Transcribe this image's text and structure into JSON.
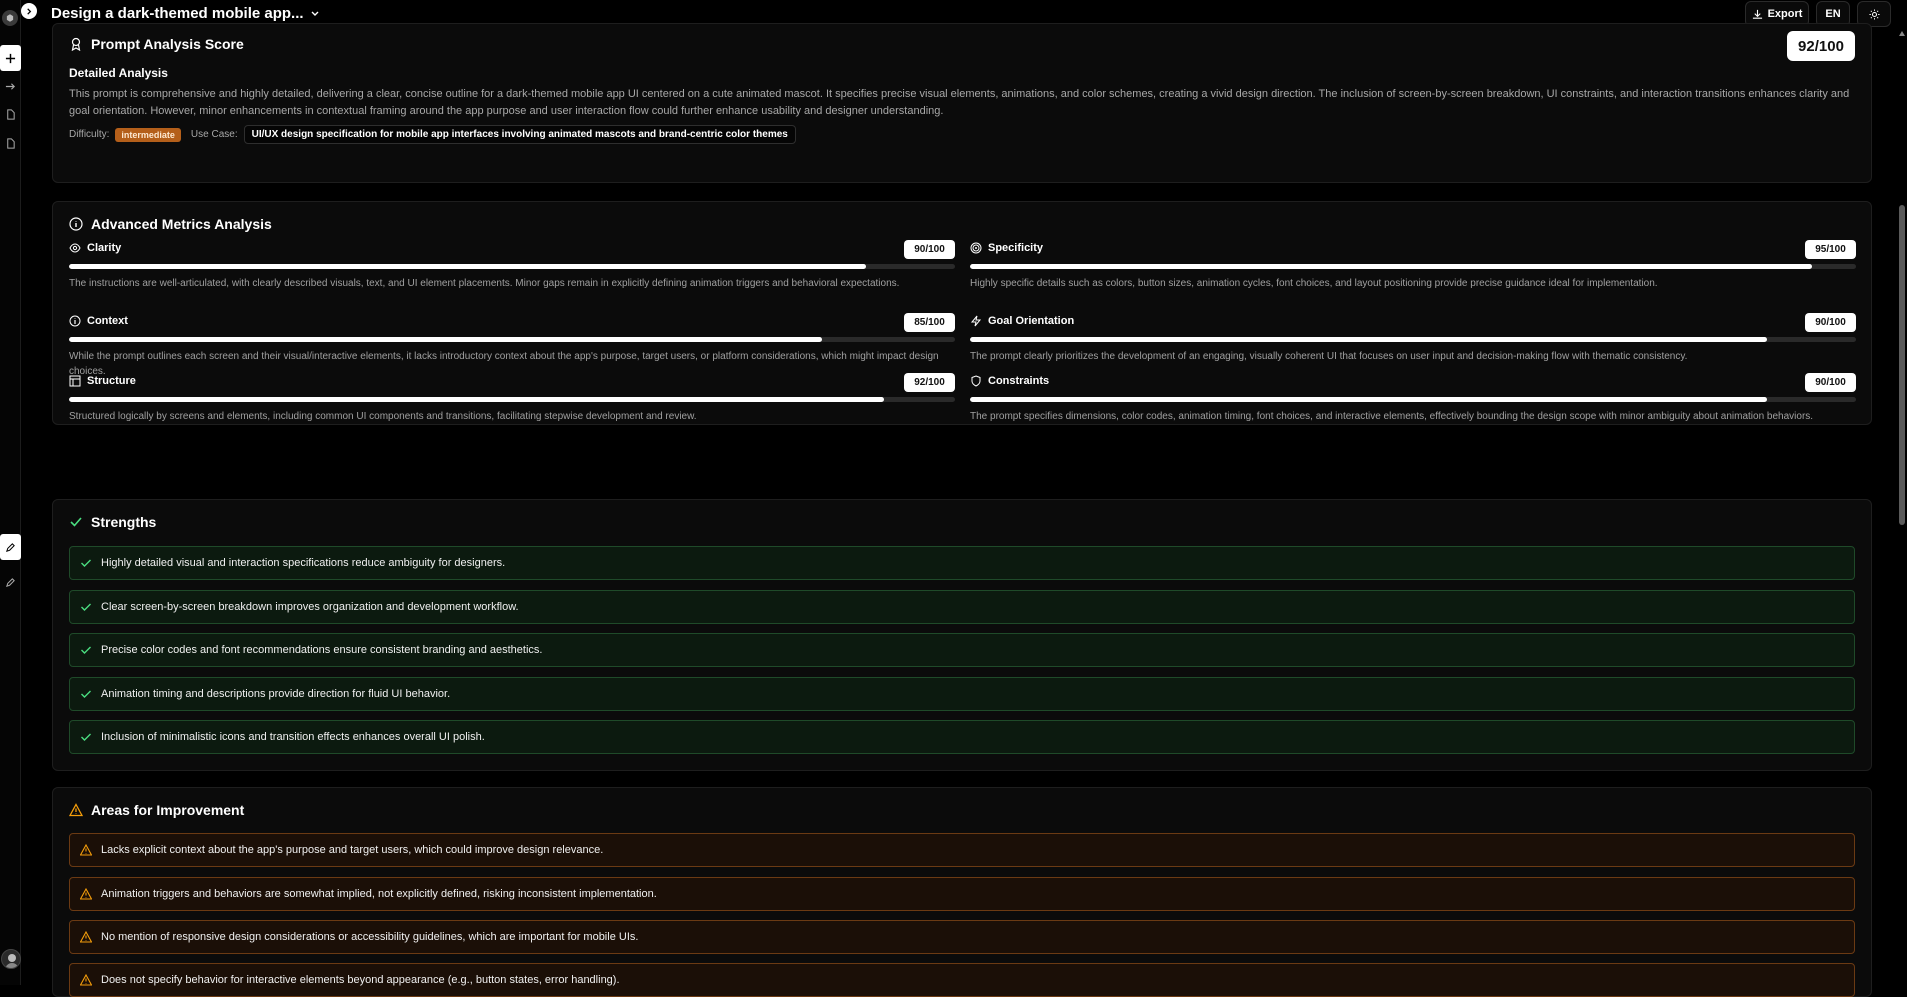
{
  "header": {
    "title": "Design a dark-themed mobile app...",
    "export_label": "Export",
    "lang_label": "EN"
  },
  "prompt_analysis": {
    "title": "Prompt Analysis Score",
    "score": "92/100",
    "detailed_title": "Detailed Analysis",
    "detailed_text": "This prompt is comprehensive and highly detailed, delivering a clear, concise outline for a dark-themed mobile app UI centered on a cute animated mascot. It specifies precise visual elements, animations, and color schemes, creating a vivid design direction. The inclusion of screen-by-screen breakdown, UI constraints, and interaction transitions enhances clarity and goal orientation. However, minor enhancements in contextual framing around the app purpose and user interaction flow could further enhance usability and designer understanding.",
    "difficulty_label": "Difficulty:",
    "difficulty_value": "intermediate",
    "use_case_label": "Use Case:",
    "use_case_value": "UI/UX design specification for mobile app interfaces involving animated mascots and brand-centric color themes"
  },
  "metrics": {
    "title": "Advanced Metrics Analysis",
    "items": [
      {
        "name": "Clarity",
        "score_text": "90/100",
        "score": 90,
        "icon": "eye-icon",
        "desc": "The instructions are well-articulated, with clearly described visuals, text, and UI element placements. Minor gaps remain in explicitly defining animation triggers and behavioral expectations."
      },
      {
        "name": "Specificity",
        "score_text": "95/100",
        "score": 95,
        "icon": "target-icon",
        "desc": "Highly specific details such as colors, button sizes, animation cycles, font choices, and layout positioning provide precise guidance ideal for implementation."
      },
      {
        "name": "Context",
        "score_text": "85/100",
        "score": 85,
        "icon": "info-icon",
        "desc": "While the prompt outlines each screen and their visual/interactive elements, it lacks introductory context about the app's purpose, target users, or platform considerations, which might impact design choices."
      },
      {
        "name": "Goal Orientation",
        "score_text": "90/100",
        "score": 90,
        "icon": "lightning-icon",
        "desc": "The prompt clearly prioritizes the development of an engaging, visually coherent UI that focuses on user input and decision-making flow with thematic consistency."
      },
      {
        "name": "Structure",
        "score_text": "92/100",
        "score": 92,
        "icon": "layout-icon",
        "desc": "Structured logically by screens and elements, including common UI components and transitions, facilitating stepwise development and review."
      },
      {
        "name": "Constraints",
        "score_text": "90/100",
        "score": 90,
        "icon": "shield-icon",
        "desc": "The prompt specifies dimensions, color codes, animation timing, font choices, and interactive elements, effectively bounding the design scope with minor ambiguity about animation behaviors."
      }
    ]
  },
  "strengths": {
    "title": "Strengths",
    "items": [
      "Highly detailed visual and interaction specifications reduce ambiguity for designers.",
      "Clear screen-by-screen breakdown improves organization and development workflow.",
      "Precise color codes and font recommendations ensure consistent branding and aesthetics.",
      "Animation timing and descriptions provide direction for fluid UI behavior.",
      "Inclusion of minimalistic icons and transition effects enhances overall UI polish."
    ]
  },
  "improvements": {
    "title": "Areas for Improvement",
    "items": [
      "Lacks explicit context about the app's purpose and target users, which could improve design relevance.",
      "Animation triggers and behaviors are somewhat implied, not explicitly defined, risking inconsistent implementation.",
      "No mention of responsive design considerations or accessibility guidelines, which are important for mobile UIs.",
      "Does not specify behavior for interactive elements beyond appearance (e.g., button states, error handling)."
    ]
  },
  "colors": {
    "accent_good": "#4ade80",
    "accent_warn": "#f59e0b",
    "difficulty_pill": "#b45f1a"
  }
}
